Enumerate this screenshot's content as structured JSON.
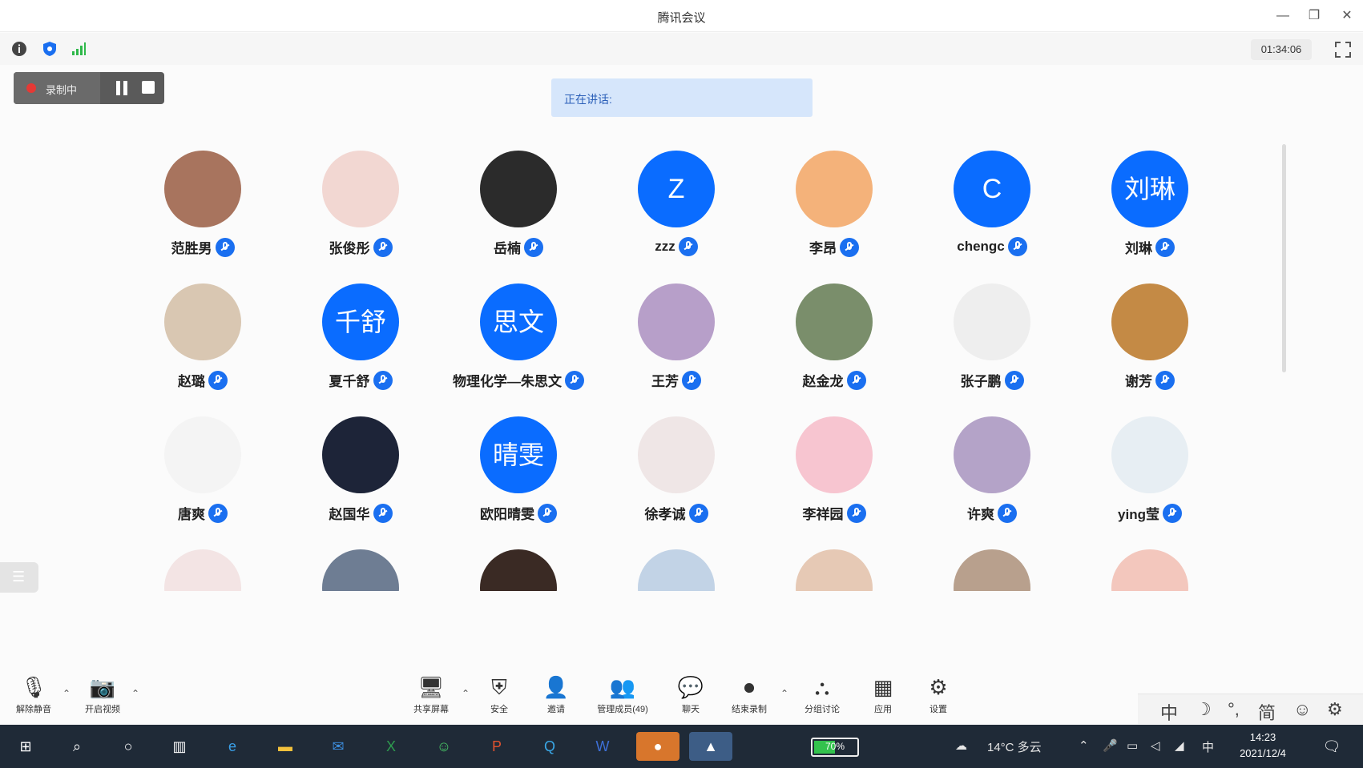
{
  "window": {
    "title": "腾讯会议",
    "minimize": "—",
    "restore": "❐",
    "close": "✕"
  },
  "infobar": {
    "timer": "01:34:06"
  },
  "recording": {
    "label": "录制中"
  },
  "speaking": {
    "label": "正在讲话:"
  },
  "participants": [
    {
      "name": "范胜男",
      "avatar_type": "photo",
      "color": "#a8745e"
    },
    {
      "name": "张俊彤",
      "avatar_type": "photo",
      "color": "#f2d7d2"
    },
    {
      "name": "岳楠",
      "avatar_type": "photo",
      "color": "#2b2b2b"
    },
    {
      "name": "zzz",
      "avatar_type": "text",
      "initials": "Z"
    },
    {
      "name": "李昂",
      "avatar_type": "photo",
      "color": "#f4b27a"
    },
    {
      "name": "chengc",
      "avatar_type": "text",
      "initials": "C"
    },
    {
      "name": "刘琳",
      "avatar_type": "text",
      "initials": "刘琳"
    },
    {
      "name": "赵璐",
      "avatar_type": "photo",
      "color": "#d9c7b2"
    },
    {
      "name": "夏千舒",
      "avatar_type": "text",
      "initials": "千舒"
    },
    {
      "name": "物理化学—朱思文",
      "avatar_type": "text",
      "initials": "思文"
    },
    {
      "name": "王芳",
      "avatar_type": "photo",
      "color": "#b79fc9"
    },
    {
      "name": "赵金龙",
      "avatar_type": "photo",
      "color": "#7a8e6b"
    },
    {
      "name": "张子鹏",
      "avatar_type": "blank",
      "color": "#eeeeee"
    },
    {
      "name": "谢芳",
      "avatar_type": "photo",
      "color": "#c48a45"
    },
    {
      "name": "唐爽",
      "avatar_type": "photo",
      "color": "#f4f4f4"
    },
    {
      "name": "赵国华",
      "avatar_type": "photo",
      "color": "#1d2438"
    },
    {
      "name": "欧阳晴雯",
      "avatar_type": "text",
      "initials": "晴雯"
    },
    {
      "name": "徐孝诚",
      "avatar_type": "photo",
      "color": "#efe6e6"
    },
    {
      "name": "李祥园",
      "avatar_type": "photo",
      "color": "#f7c5d0"
    },
    {
      "name": "许爽",
      "avatar_type": "photo",
      "color": "#b4a3c8"
    },
    {
      "name": "ying莹",
      "avatar_type": "photo",
      "color": "#e7eef3"
    },
    {
      "name": "",
      "avatar_type": "photo",
      "color": "#f3e4e4"
    },
    {
      "name": "",
      "avatar_type": "photo",
      "color": "#6e7d93"
    },
    {
      "name": "",
      "avatar_type": "photo",
      "color": "#3a2a24"
    },
    {
      "name": "",
      "avatar_type": "photo",
      "color": "#c2d3e6"
    },
    {
      "name": "",
      "avatar_type": "photo",
      "color": "#e6c9b5"
    },
    {
      "name": "",
      "avatar_type": "photo",
      "color": "#b8a08d"
    },
    {
      "name": "",
      "avatar_type": "photo",
      "color": "#f3c7bd"
    }
  ],
  "toolbar": {
    "unmute": "解除静音",
    "start_video": "开启视频",
    "share_screen": "共享屏幕",
    "security": "安全",
    "invite": "邀请",
    "manage_members": "管理成员(49)",
    "chat": "聊天",
    "end_recording": "结束录制",
    "breakout": "分组讨论",
    "apps": "应用",
    "settings": "设置"
  },
  "ime": {
    "lang": "中",
    "moon": "☽",
    "punct": "°,",
    "simplified": "简",
    "emoji": "☺",
    "gear": "⚙"
  },
  "taskbar": {
    "battery": "70%",
    "weather": "14°C 多云",
    "ime": "中",
    "time": "14:23",
    "date": "2021/12/4"
  }
}
